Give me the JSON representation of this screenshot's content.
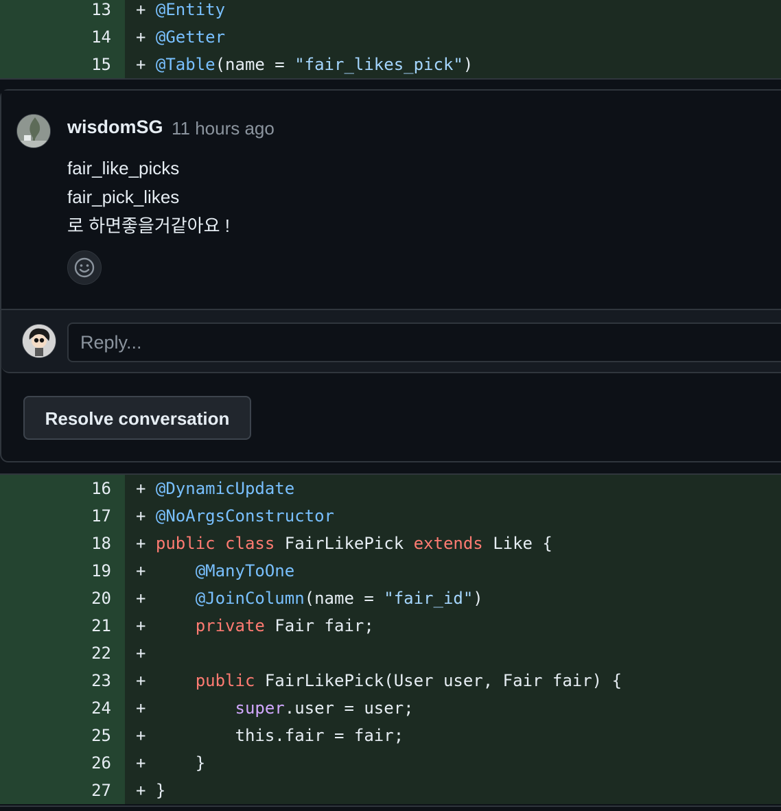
{
  "diff_top": [
    {
      "line": "13",
      "marker": "+",
      "tokens": [
        {
          "t": "@Entity",
          "c": "ann"
        }
      ]
    },
    {
      "line": "14",
      "marker": "+",
      "tokens": [
        {
          "t": "@Getter",
          "c": "ann"
        }
      ]
    },
    {
      "line": "15",
      "marker": "+",
      "tokens": [
        {
          "t": "@Table",
          "c": "ann"
        },
        {
          "t": "(name = ",
          "c": "plain"
        },
        {
          "t": "\"fair_likes_pick\"",
          "c": "str"
        },
        {
          "t": ")",
          "c": "plain"
        }
      ]
    }
  ],
  "comment": {
    "author": "wisdomSG",
    "time": "11 hours ago",
    "lines": [
      "fair_like_picks",
      "fair_pick_likes",
      "로 하면좋을거같아요 !"
    ],
    "reaction_icon": "smiley-icon"
  },
  "reply": {
    "placeholder": "Reply..."
  },
  "resolve_label": "Resolve conversation",
  "diff_bottom": [
    {
      "line": "16",
      "marker": "+",
      "tokens": [
        {
          "t": "@DynamicUpdate",
          "c": "ann"
        }
      ]
    },
    {
      "line": "17",
      "marker": "+",
      "tokens": [
        {
          "t": "@NoArgsConstructor",
          "c": "ann"
        }
      ]
    },
    {
      "line": "18",
      "marker": "+",
      "tokens": [
        {
          "t": "public class ",
          "c": "kw"
        },
        {
          "t": "FairLikePick ",
          "c": "plain"
        },
        {
          "t": "extends ",
          "c": "kw"
        },
        {
          "t": "Like {",
          "c": "plain"
        }
      ]
    },
    {
      "line": "19",
      "marker": "+",
      "tokens": [
        {
          "t": "    ",
          "c": "plain"
        },
        {
          "t": "@ManyToOne",
          "c": "ann"
        }
      ]
    },
    {
      "line": "20",
      "marker": "+",
      "tokens": [
        {
          "t": "    ",
          "c": "plain"
        },
        {
          "t": "@JoinColumn",
          "c": "ann"
        },
        {
          "t": "(name = ",
          "c": "plain"
        },
        {
          "t": "\"fair_id\"",
          "c": "str"
        },
        {
          "t": ")",
          "c": "plain"
        }
      ]
    },
    {
      "line": "21",
      "marker": "+",
      "tokens": [
        {
          "t": "    ",
          "c": "plain"
        },
        {
          "t": "private ",
          "c": "kw"
        },
        {
          "t": "Fair fair;",
          "c": "plain"
        }
      ]
    },
    {
      "line": "22",
      "marker": "+",
      "tokens": []
    },
    {
      "line": "23",
      "marker": "+",
      "tokens": [
        {
          "t": "    ",
          "c": "plain"
        },
        {
          "t": "public ",
          "c": "kw"
        },
        {
          "t": "FairLikePick(User user, Fair fair) {",
          "c": "plain"
        }
      ]
    },
    {
      "line": "24",
      "marker": "+",
      "tokens": [
        {
          "t": "        ",
          "c": "plain"
        },
        {
          "t": "super",
          "c": "super"
        },
        {
          "t": ".user = user;",
          "c": "plain"
        }
      ]
    },
    {
      "line": "25",
      "marker": "+",
      "tokens": [
        {
          "t": "        this.fair = fair;",
          "c": "plain"
        }
      ]
    },
    {
      "line": "26",
      "marker": "+",
      "tokens": [
        {
          "t": "    }",
          "c": "plain"
        }
      ]
    },
    {
      "line": "27",
      "marker": "+",
      "tokens": [
        {
          "t": "}",
          "c": "plain"
        }
      ]
    }
  ]
}
